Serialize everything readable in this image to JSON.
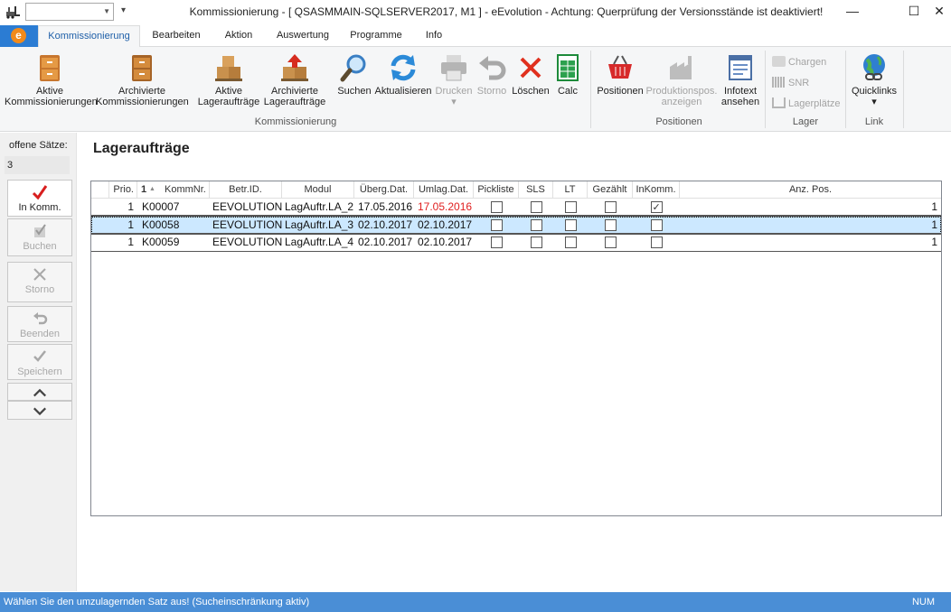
{
  "window": {
    "title": "Kommissionierung - [ QSASMMAIN-SQLSERVER2017, M1 ]  -  eEvolution - Achtung: Querprüfung der Versionsstände ist deaktiviert!",
    "quick_combo_value": ""
  },
  "tabs": [
    "Kommissionierung",
    "Bearbeiten",
    "Aktion",
    "Auswertung",
    "Programme",
    "Info"
  ],
  "ribbon": {
    "groups": {
      "kommissionierung": "Kommissionierung",
      "positionen": "Positionen",
      "lager": "Lager",
      "link": "Link"
    },
    "buttons": {
      "aktive_komm": [
        "Aktive",
        "Kommissionierungen"
      ],
      "archiv_komm": [
        "Archivierte",
        "Kommissionierungen"
      ],
      "aktive_lager": [
        "Aktive",
        "Lageraufträge"
      ],
      "archiv_lager": [
        "Archivierte",
        "Lageraufträge"
      ],
      "suchen": "Suchen",
      "aktualisieren": "Aktualisieren",
      "drucken": "Drucken",
      "storno": "Storno",
      "loeschen": "Löschen",
      "calc": "Calc",
      "positionen": "Positionen",
      "produktionspos": [
        "Produktionspos.",
        "anzeigen"
      ],
      "infotext": [
        "Infotext",
        "ansehen"
      ],
      "chargen": "Chargen",
      "snr": "SNR",
      "lagerplaetze": "Lagerplätze",
      "quicklinks": "Quicklinks"
    }
  },
  "left_panel": {
    "open_label": "offene Sätze:",
    "open_count": "3",
    "buttons": {
      "in_komm": "In Komm.",
      "buchen": "Buchen",
      "storno": "Storno",
      "beenden": "Beenden",
      "speichern": "Speichern"
    }
  },
  "main": {
    "title": "Lageraufträge",
    "sort_indicator": "1",
    "columns": [
      "Prio.",
      "KommNr.",
      "Betr.ID.",
      "Modul",
      "Überg.Dat.",
      "Umlag.Dat.",
      "Pickliste",
      "SLS",
      "LT",
      "Gezählt",
      "InKomm.",
      "Anz. Pos."
    ],
    "rows": [
      {
        "prio": "1",
        "kommnr": "K00007",
        "betr": "EEVOLUTION",
        "modul": "LagAuftr.LA_2",
        "uebergdat": "17.05.2016",
        "umlagdat": "17.05.2016",
        "pickliste": false,
        "sls": false,
        "lt": false,
        "gezaehlt": false,
        "inkomm": true,
        "anzpos": "1"
      },
      {
        "prio": "1",
        "kommnr": "K00058",
        "betr": "EEVOLUTION",
        "modul": "LagAuftr.LA_3",
        "uebergdat": "02.10.2017",
        "umlagdat": "02.10.2017",
        "pickliste": false,
        "sls": false,
        "lt": false,
        "gezaehlt": false,
        "inkomm": false,
        "anzpos": "1"
      },
      {
        "prio": "1",
        "kommnr": "K00059",
        "betr": "EEVOLUTION",
        "modul": "LagAuftr.LA_4",
        "uebergdat": "02.10.2017",
        "umlagdat": "02.10.2017",
        "pickliste": false,
        "sls": false,
        "lt": false,
        "gezaehlt": false,
        "inkomm": false,
        "anzpos": "1"
      }
    ],
    "overdue_color": "#e02020",
    "selected_row_color": "#cce8ff"
  },
  "status": {
    "text": "Wählen Sie den umzulagernden Satz aus! (Sucheinschränkung aktiv)",
    "num": "NUM"
  }
}
